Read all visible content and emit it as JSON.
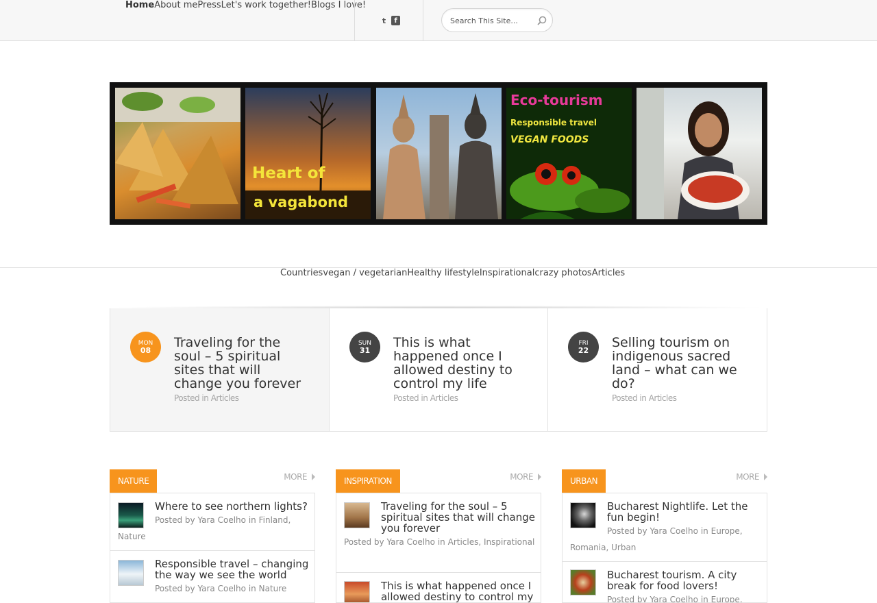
{
  "top_nav": {
    "items": [
      "Home",
      "About me",
      "Press",
      "Let's work together!",
      "Blogs I love!"
    ]
  },
  "social": {
    "twitter": "t",
    "facebook": "f"
  },
  "search": {
    "placeholder": "Search This Site..."
  },
  "banner": {
    "title_line1": "Heart of",
    "title_line2": "a vagabond",
    "eco_title": "Eco-tourism",
    "eco_line1": "Responsible travel",
    "eco_line2": "VEGAN FOODS"
  },
  "category_nav": {
    "items": [
      "Countries",
      "vegan / vegetarian",
      "Healthy lifestyle",
      "Inspirational",
      "crazy photos",
      "Articles"
    ]
  },
  "featured": [
    {
      "dow": "MON",
      "day": "08",
      "title": "Traveling for the soul – 5 spiritual sites that will change you forever",
      "posted_in": "Posted in",
      "category": "Articles"
    },
    {
      "dow": "SUN",
      "day": "31",
      "title": "This is what happened once I allowed destiny to control my life",
      "posted_in": "Posted in",
      "category": "Articles"
    },
    {
      "dow": "FRI",
      "day": "22",
      "title": "Selling tourism on indigenous sacred land – what can we do?",
      "posted_in": "Posted in",
      "category": "Articles"
    }
  ],
  "columns": [
    {
      "tab": "NATURE",
      "more": "MORE",
      "posts": [
        {
          "title": "Where to see northern lights?",
          "meta_prefix": "Posted by",
          "author": "Yara Coelho",
          "in": "in",
          "categories": "Finland, Nature"
        },
        {
          "title": "Responsible travel – changing the way we see the world",
          "meta_prefix": "Posted by",
          "author": "Yara Coelho",
          "in": "in",
          "categories": "Nature"
        }
      ]
    },
    {
      "tab": "INSPIRATION",
      "more": "MORE",
      "posts": [
        {
          "title": "Traveling for the soul – 5 spiritual sites that will change you forever",
          "meta_prefix": "Posted by",
          "author": "Yara Coelho",
          "in": "in",
          "categories": "Articles, Inspirational"
        },
        {
          "title": "This is what happened once I allowed destiny to control my life",
          "meta_prefix": "",
          "author": "",
          "in": "",
          "categories": ""
        }
      ]
    },
    {
      "tab": "URBAN",
      "more": "MORE",
      "posts": [
        {
          "title": "Bucharest Nightlife. Let the fun begin!",
          "meta_prefix": "Posted by",
          "author": "Yara Coelho",
          "in": "in",
          "categories": "Europe, Romania, Urban"
        },
        {
          "title": "Bucharest tourism. A city break for food lovers!",
          "meta_prefix": "Posted by",
          "author": "Yara Coelho",
          "in": "in",
          "categories": "Europe,"
        }
      ]
    }
  ],
  "colors": {
    "accent_orange": "#f7941d",
    "badge_dark": "#444444",
    "link_gray": "#a6a6a6"
  }
}
